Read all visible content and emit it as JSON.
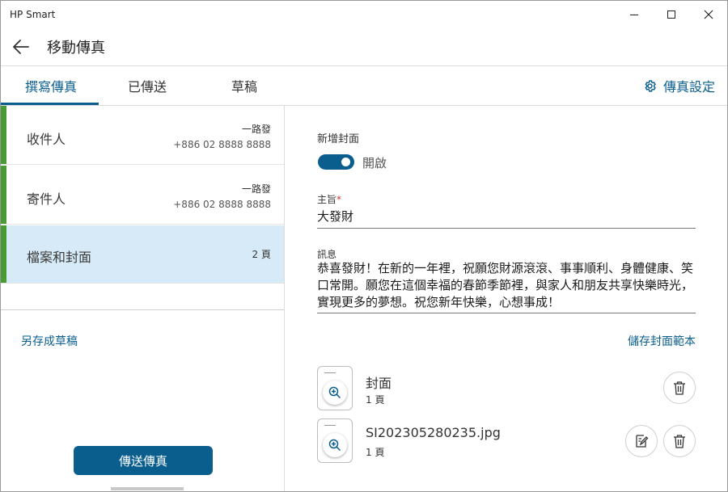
{
  "window": {
    "app_title": "HP Smart"
  },
  "header": {
    "title": "移動傳真"
  },
  "tabs": [
    {
      "label": "撰寫傳真",
      "active": true
    },
    {
      "label": "已傳送",
      "active": false
    },
    {
      "label": "草稿",
      "active": false
    }
  ],
  "fax_settings": {
    "label": "傳真設定",
    "icon": "gear-icon"
  },
  "left_rows": [
    {
      "label": "收件人",
      "meta1": "一路發",
      "meta2": "+886 02 8888 8888"
    },
    {
      "label": "寄件人",
      "meta1": "一路發",
      "meta2": "+886 02 8888 8888"
    },
    {
      "label": "檔案和封面",
      "meta1": "2 頁",
      "selected": true
    }
  ],
  "save_draft": "另存成草稿",
  "send_button": "傳送傳真",
  "cover": {
    "label": "新增封面",
    "toggle_state": "開啟",
    "enabled": true
  },
  "subject": {
    "label": "主旨",
    "required_mark": "*",
    "value": "大發財"
  },
  "message": {
    "label": "訊息",
    "value": "恭喜發財！在新的一年裡，祝願您財源滾滾、事事順利、身體健康、笑口常開。願您在這個幸福的春節季節裡，與家人和朋友共享快樂時光，實現更多的夢想。祝您新年快樂，心想事成！"
  },
  "save_cover_template": "儲存封面範本",
  "files": [
    {
      "name": "封面",
      "pages": "1 頁"
    },
    {
      "name": "SI202305280235.jpg",
      "pages": "1 頁"
    }
  ],
  "colors": {
    "accent": "#0a5e8e",
    "green_bar": "#4a9a34",
    "selected_row": "#d6eaf7"
  }
}
